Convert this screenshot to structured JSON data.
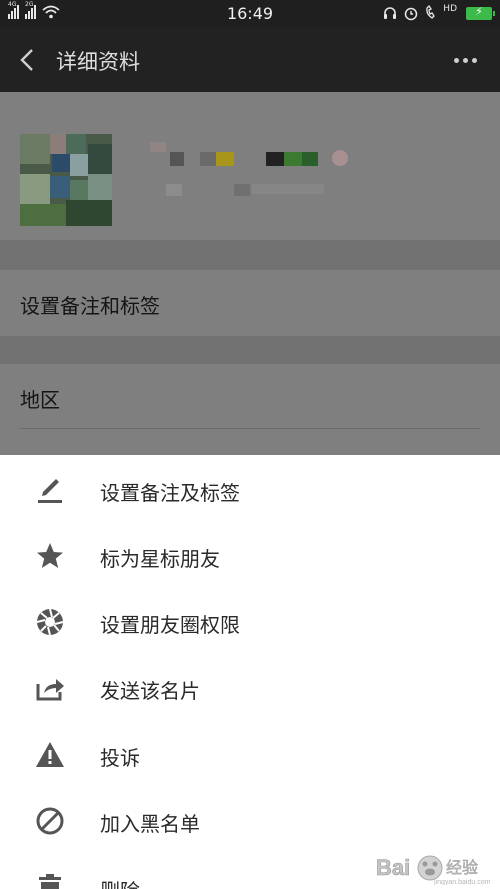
{
  "status_bar": {
    "network_1": "4G",
    "network_2": "2G",
    "time": "16:49",
    "icons": [
      "headset-icon",
      "alarm-icon",
      "hd-call-icon",
      "battery-icon"
    ],
    "hd_label": "HD"
  },
  "header": {
    "title": "详细资料",
    "back_icon": "chevron-left-icon",
    "more_icon": "more-dots-icon"
  },
  "background_page": {
    "remark_row": "设置备注和标签",
    "region_row": "地区"
  },
  "menu": {
    "items": [
      {
        "label": "设置备注及标签",
        "icon": "pencil-icon"
      },
      {
        "label": "标为星标朋友",
        "icon": "star-icon"
      },
      {
        "label": "设置朋友圈权限",
        "icon": "aperture-icon"
      },
      {
        "label": "发送该名片",
        "icon": "share-icon"
      },
      {
        "label": "投诉",
        "icon": "warning-icon"
      },
      {
        "label": "加入黑名单",
        "icon": "block-icon"
      },
      {
        "label": "删除",
        "icon": "trash-icon"
      }
    ]
  },
  "watermark": {
    "text": "Bai 经验",
    "sub": "jingyan.baidu.com"
  },
  "colors": {
    "sheet_bg": "#ffffff",
    "icon": "#555555",
    "battery": "#3dbb4a"
  }
}
